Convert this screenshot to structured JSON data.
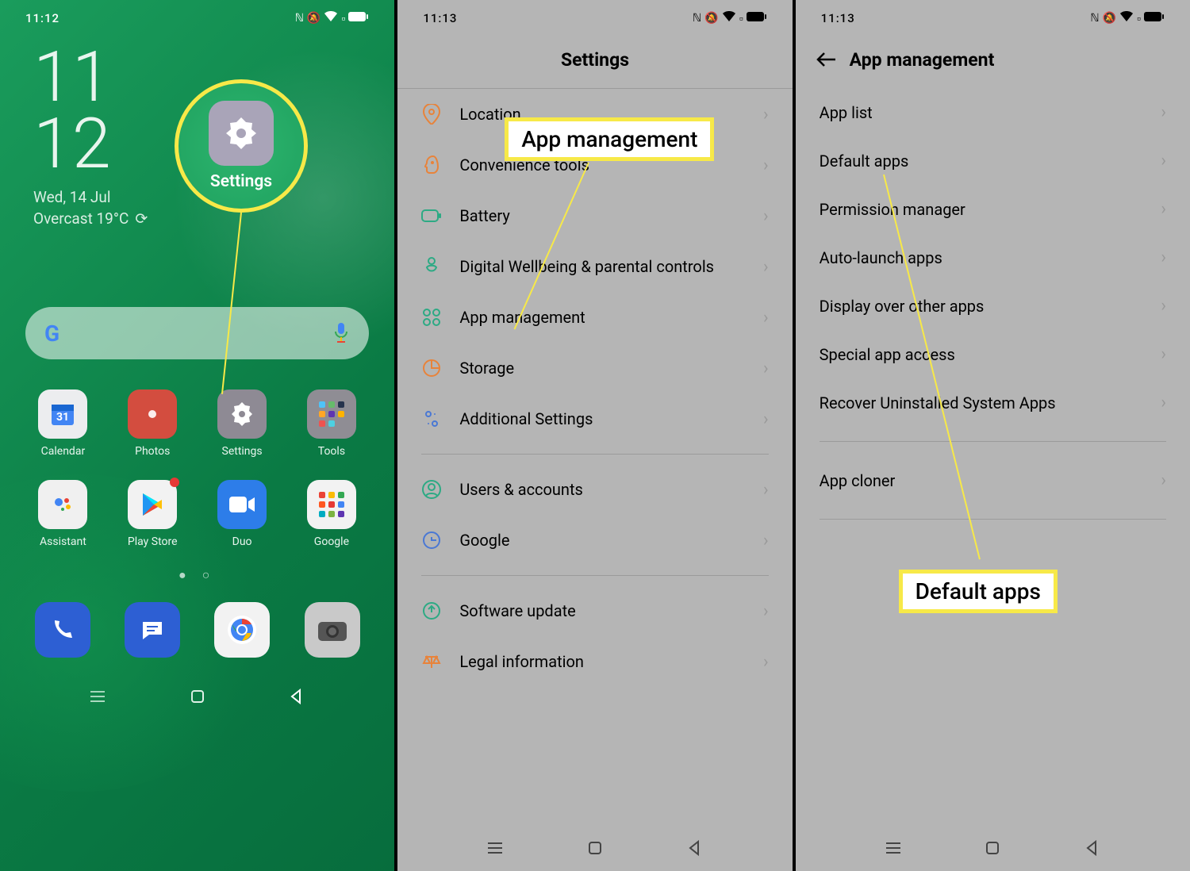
{
  "phone1": {
    "status_time": "11:12",
    "clock_h": "11",
    "clock_m": "12",
    "date": "Wed, 14 Jul",
    "weather": "Overcast 19°C",
    "callout_label": "Settings",
    "apps": {
      "calendar": "Calendar",
      "photos": "Photos",
      "settings": "Settings",
      "tools": "Tools",
      "assistant": "Assistant",
      "play": "Play Store",
      "duo": "Duo",
      "google": "Google"
    }
  },
  "phone2": {
    "status_time": "11:13",
    "title": "Settings",
    "callout": "App management",
    "rows": {
      "location": "Location",
      "convenience": "Convenience tools",
      "battery": "Battery",
      "wellbeing": "Digital Wellbeing & parental controls",
      "appmgmt": "App management",
      "storage": "Storage",
      "additional": "Additional Settings",
      "users": "Users & accounts",
      "google": "Google",
      "software": "Software update",
      "legal": "Legal information"
    }
  },
  "phone3": {
    "status_time": "11:13",
    "title": "App management",
    "callout": "Default apps",
    "rows": {
      "applist": "App list",
      "default": "Default apps",
      "permission": "Permission manager",
      "autolaunch": "Auto-launch apps",
      "displayover": "Display over other apps",
      "special": "Special app access",
      "recover": "Recover Uninstalled System Apps",
      "cloner": "App cloner"
    }
  }
}
